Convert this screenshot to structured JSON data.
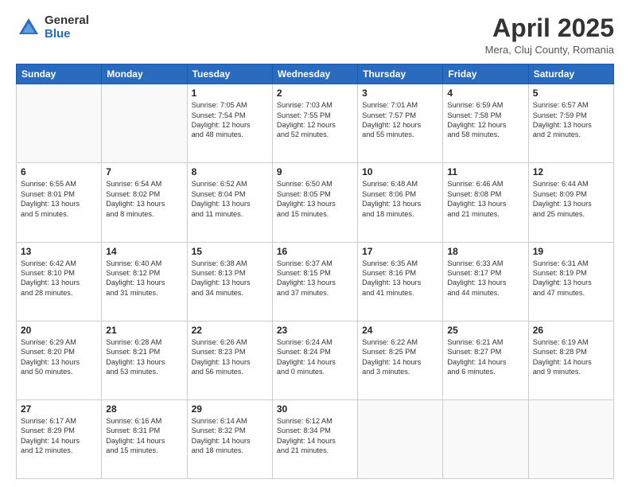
{
  "logo": {
    "general": "General",
    "blue": "Blue"
  },
  "header": {
    "month_year": "April 2025",
    "location": "Mera, Cluj County, Romania"
  },
  "days_of_week": [
    "Sunday",
    "Monday",
    "Tuesday",
    "Wednesday",
    "Thursday",
    "Friday",
    "Saturday"
  ],
  "weeks": [
    [
      {
        "day": "",
        "info": ""
      },
      {
        "day": "",
        "info": ""
      },
      {
        "day": "1",
        "info": "Sunrise: 7:05 AM\nSunset: 7:54 PM\nDaylight: 12 hours\nand 48 minutes."
      },
      {
        "day": "2",
        "info": "Sunrise: 7:03 AM\nSunset: 7:55 PM\nDaylight: 12 hours\nand 52 minutes."
      },
      {
        "day": "3",
        "info": "Sunrise: 7:01 AM\nSunset: 7:57 PM\nDaylight: 12 hours\nand 55 minutes."
      },
      {
        "day": "4",
        "info": "Sunrise: 6:59 AM\nSunset: 7:58 PM\nDaylight: 12 hours\nand 58 minutes."
      },
      {
        "day": "5",
        "info": "Sunrise: 6:57 AM\nSunset: 7:59 PM\nDaylight: 13 hours\nand 2 minutes."
      }
    ],
    [
      {
        "day": "6",
        "info": "Sunrise: 6:55 AM\nSunset: 8:01 PM\nDaylight: 13 hours\nand 5 minutes."
      },
      {
        "day": "7",
        "info": "Sunrise: 6:54 AM\nSunset: 8:02 PM\nDaylight: 13 hours\nand 8 minutes."
      },
      {
        "day": "8",
        "info": "Sunrise: 6:52 AM\nSunset: 8:04 PM\nDaylight: 13 hours\nand 11 minutes."
      },
      {
        "day": "9",
        "info": "Sunrise: 6:50 AM\nSunset: 8:05 PM\nDaylight: 13 hours\nand 15 minutes."
      },
      {
        "day": "10",
        "info": "Sunrise: 6:48 AM\nSunset: 8:06 PM\nDaylight: 13 hours\nand 18 minutes."
      },
      {
        "day": "11",
        "info": "Sunrise: 6:46 AM\nSunset: 8:08 PM\nDaylight: 13 hours\nand 21 minutes."
      },
      {
        "day": "12",
        "info": "Sunrise: 6:44 AM\nSunset: 8:09 PM\nDaylight: 13 hours\nand 25 minutes."
      }
    ],
    [
      {
        "day": "13",
        "info": "Sunrise: 6:42 AM\nSunset: 8:10 PM\nDaylight: 13 hours\nand 28 minutes."
      },
      {
        "day": "14",
        "info": "Sunrise: 6:40 AM\nSunset: 8:12 PM\nDaylight: 13 hours\nand 31 minutes."
      },
      {
        "day": "15",
        "info": "Sunrise: 6:38 AM\nSunset: 8:13 PM\nDaylight: 13 hours\nand 34 minutes."
      },
      {
        "day": "16",
        "info": "Sunrise: 6:37 AM\nSunset: 8:15 PM\nDaylight: 13 hours\nand 37 minutes."
      },
      {
        "day": "17",
        "info": "Sunrise: 6:35 AM\nSunset: 8:16 PM\nDaylight: 13 hours\nand 41 minutes."
      },
      {
        "day": "18",
        "info": "Sunrise: 6:33 AM\nSunset: 8:17 PM\nDaylight: 13 hours\nand 44 minutes."
      },
      {
        "day": "19",
        "info": "Sunrise: 6:31 AM\nSunset: 8:19 PM\nDaylight: 13 hours\nand 47 minutes."
      }
    ],
    [
      {
        "day": "20",
        "info": "Sunrise: 6:29 AM\nSunset: 8:20 PM\nDaylight: 13 hours\nand 50 minutes."
      },
      {
        "day": "21",
        "info": "Sunrise: 6:28 AM\nSunset: 8:21 PM\nDaylight: 13 hours\nand 53 minutes."
      },
      {
        "day": "22",
        "info": "Sunrise: 6:26 AM\nSunset: 8:23 PM\nDaylight: 13 hours\nand 56 minutes."
      },
      {
        "day": "23",
        "info": "Sunrise: 6:24 AM\nSunset: 8:24 PM\nDaylight: 14 hours\nand 0 minutes."
      },
      {
        "day": "24",
        "info": "Sunrise: 6:22 AM\nSunset: 8:25 PM\nDaylight: 14 hours\nand 3 minutes."
      },
      {
        "day": "25",
        "info": "Sunrise: 6:21 AM\nSunset: 8:27 PM\nDaylight: 14 hours\nand 6 minutes."
      },
      {
        "day": "26",
        "info": "Sunrise: 6:19 AM\nSunset: 8:28 PM\nDaylight: 14 hours\nand 9 minutes."
      }
    ],
    [
      {
        "day": "27",
        "info": "Sunrise: 6:17 AM\nSunset: 8:29 PM\nDaylight: 14 hours\nand 12 minutes."
      },
      {
        "day": "28",
        "info": "Sunrise: 6:16 AM\nSunset: 8:31 PM\nDaylight: 14 hours\nand 15 minutes."
      },
      {
        "day": "29",
        "info": "Sunrise: 6:14 AM\nSunset: 8:32 PM\nDaylight: 14 hours\nand 18 minutes."
      },
      {
        "day": "30",
        "info": "Sunrise: 6:12 AM\nSunset: 8:34 PM\nDaylight: 14 hours\nand 21 minutes."
      },
      {
        "day": "",
        "info": ""
      },
      {
        "day": "",
        "info": ""
      },
      {
        "day": "",
        "info": ""
      }
    ]
  ]
}
